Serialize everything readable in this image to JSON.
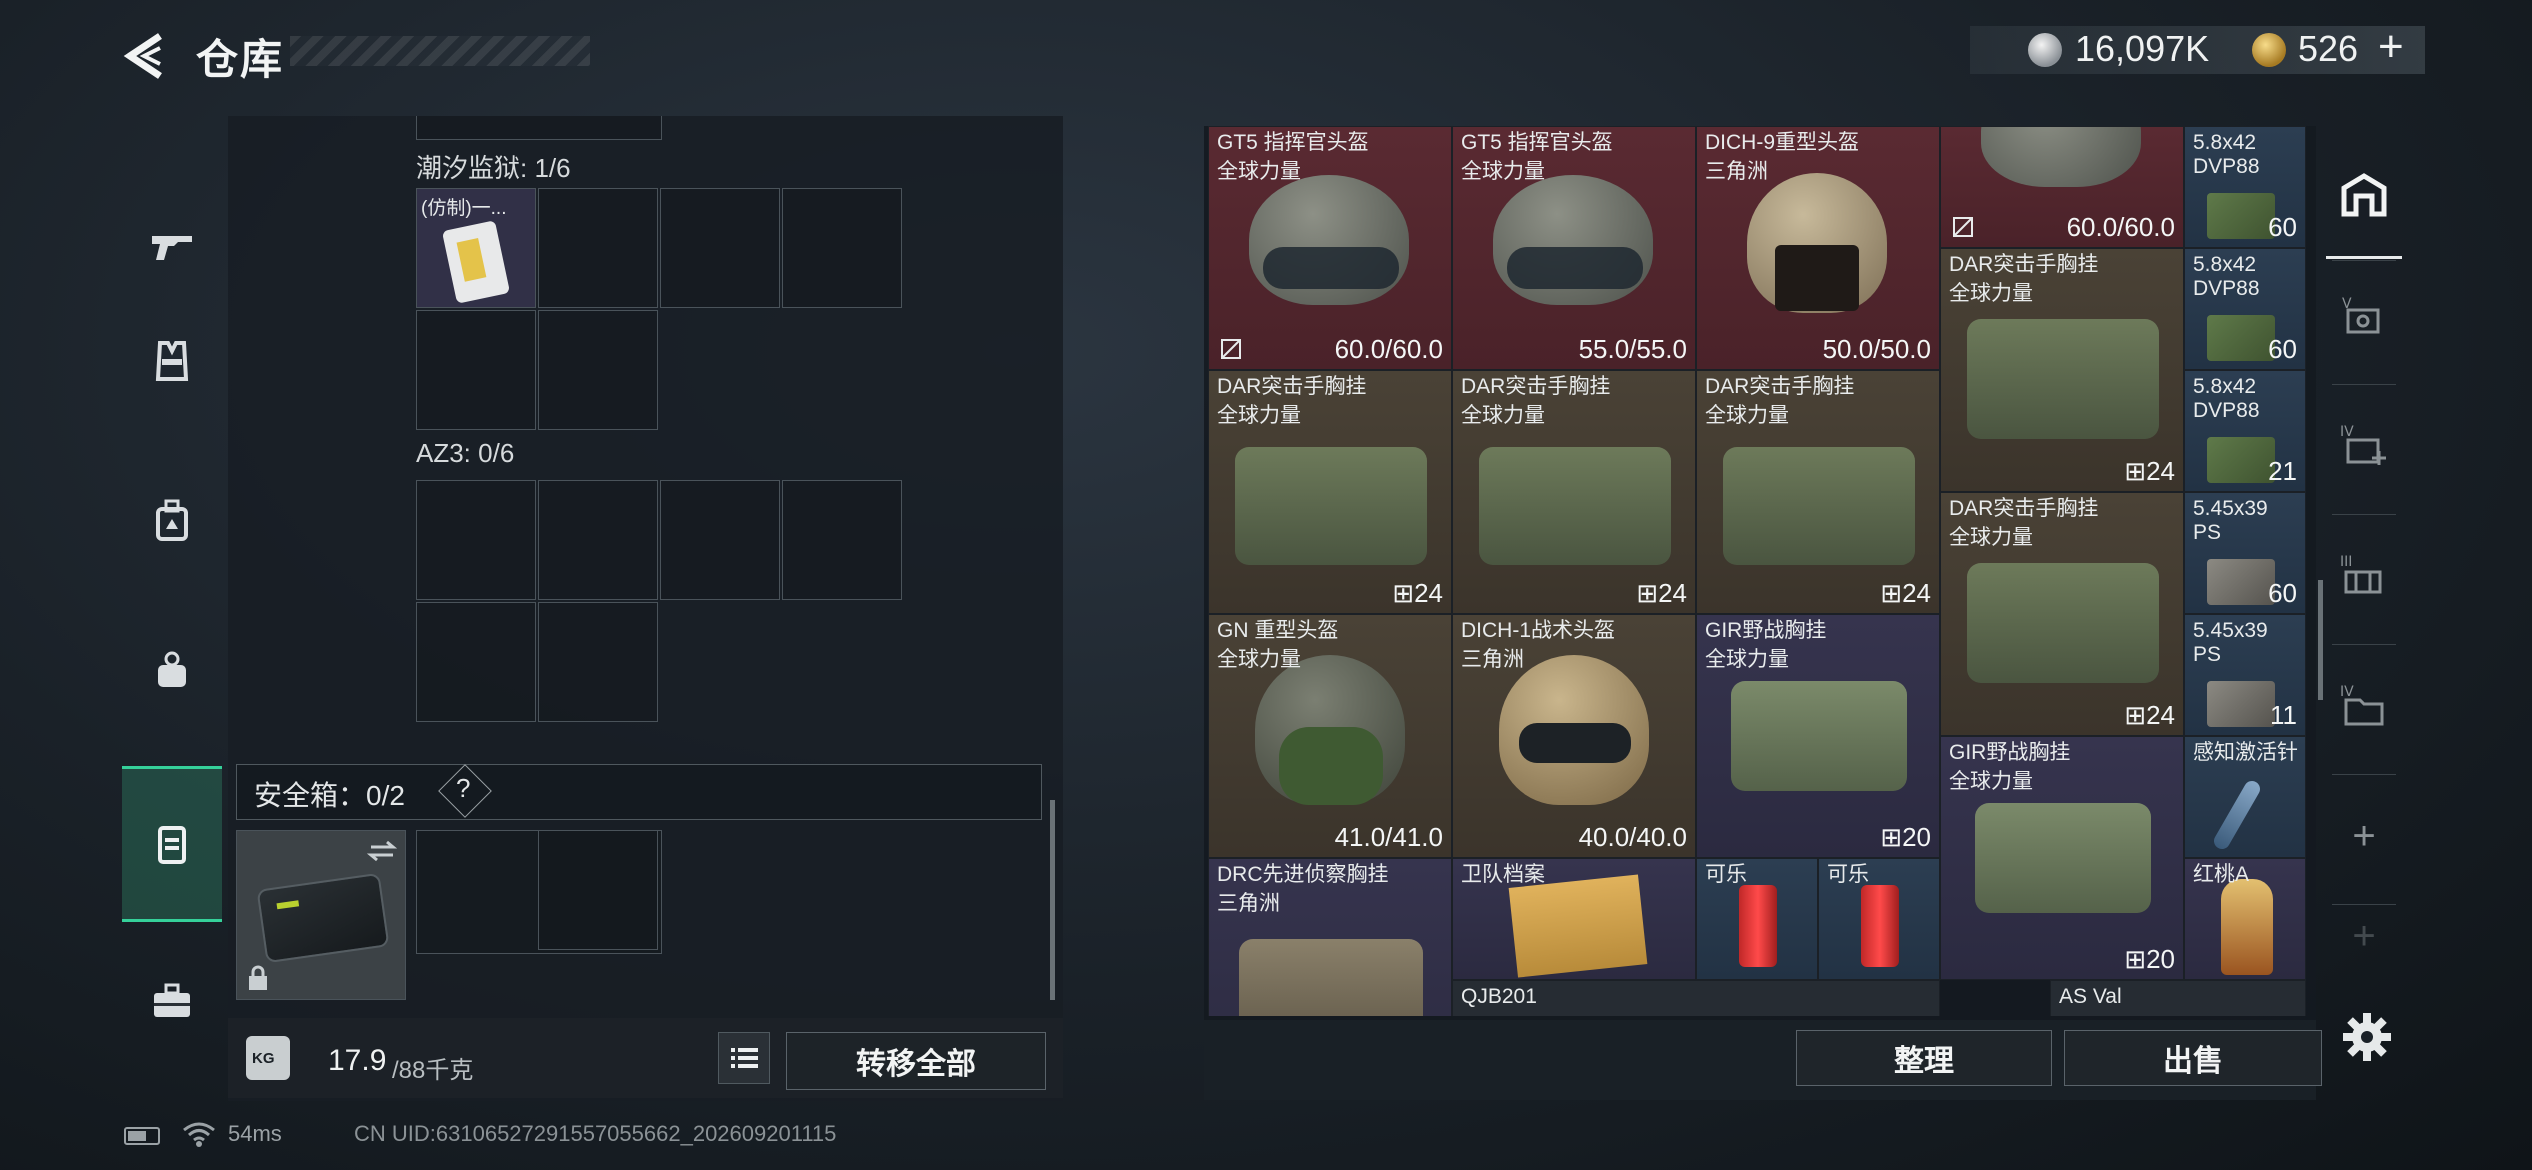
{
  "header": {
    "title": "仓库",
    "currency1_value": "16,097K",
    "currency2_value": "526",
    "currency2_plus": "+"
  },
  "left_nav": {
    "items": [
      "weapon-icon",
      "vest-icon",
      "backpack-icon",
      "bag-icon",
      "safebox-icon",
      "toolbox-icon"
    ],
    "active": "safebox-icon"
  },
  "left_panel": {
    "slot1_title": "潮汐监狱: 1/6",
    "slot1_item": "(仿制)一...",
    "slot2_title": "AZ3: 0/6",
    "secure_label": "安全箱：0/2",
    "secure_help": "?"
  },
  "weight": {
    "icon_text": "KG",
    "current": "17.9",
    "max": "/88千克"
  },
  "buttons": {
    "transfer_all": "转移全部",
    "sort": "整理",
    "sell": "出售"
  },
  "status": {
    "ping": "54ms",
    "uid": "CN UID:631065272915570556​62_202609201115"
  },
  "items": [
    {
      "name": "GT5 指挥官头盔",
      "sub": "全球力量",
      "value": "60.0/60.0"
    },
    {
      "name": "GT5 指挥官头盔",
      "sub": "全球力量",
      "value": "55.0/55.0"
    },
    {
      "name": "DICH-9重型头盔",
      "sub": "三角洲",
      "value": "50.0/50.0"
    },
    {
      "name": "",
      "sub": "",
      "value": "60.0/60.0"
    },
    {
      "name": "5.8x42",
      "sub": "DVP88",
      "value": "60"
    },
    {
      "name": "DAR突击手胸挂",
      "sub": "全球力量",
      "value": "24"
    },
    {
      "name": "5.8x42",
      "sub": "DVP88",
      "value": "60"
    },
    {
      "name": "DAR突击手胸挂",
      "sub": "全球力量",
      "value": "24"
    },
    {
      "name": "DAR突击手胸挂",
      "sub": "全球力量",
      "value": "24"
    },
    {
      "name": "DAR突击手胸挂",
      "sub": "全球力量",
      "value": "24"
    },
    {
      "name": "5.8x42",
      "sub": "DVP88",
      "value": "21"
    },
    {
      "name": "DAR突击手胸挂",
      "sub": "全球力量",
      "value": "24"
    },
    {
      "name": "5.45x39",
      "sub": "PS",
      "value": "60"
    },
    {
      "name": "GN 重型头盔",
      "sub": "全球力量",
      "value": "41.0/41.0"
    },
    {
      "name": "DICH-1战术头盔",
      "sub": "三角洲",
      "value": "40.0/40.0"
    },
    {
      "name": "GIR野战胸挂",
      "sub": "全球力量",
      "value": "20"
    },
    {
      "name": "5.45x39",
      "sub": "PS",
      "value": "11"
    },
    {
      "name": "GIR野战胸挂",
      "sub": "全球力量",
      "value": "20"
    },
    {
      "name": "感知激活针",
      "sub": "",
      "value": ""
    },
    {
      "name": "DRC先进侦察胸挂",
      "sub": "三角洲",
      "value": ""
    },
    {
      "name": "卫队档案",
      "sub": "",
      "value": ""
    },
    {
      "name": "可乐",
      "sub": "",
      "value": ""
    },
    {
      "name": "可乐",
      "sub": "",
      "value": ""
    },
    {
      "name": "红桃A",
      "sub": "",
      "value": ""
    },
    {
      "name": "QJB201",
      "sub": "",
      "value": ""
    },
    {
      "name": "AS Val",
      "sub": "",
      "value": ""
    }
  ],
  "side_nav": {
    "items": [
      "safehouse-icon",
      "v-case-icon",
      "iv-medkit-icon",
      "iii-armor-icon",
      "iv-folder-icon",
      "add-icon",
      "add-icon"
    ],
    "add_label": "+"
  }
}
